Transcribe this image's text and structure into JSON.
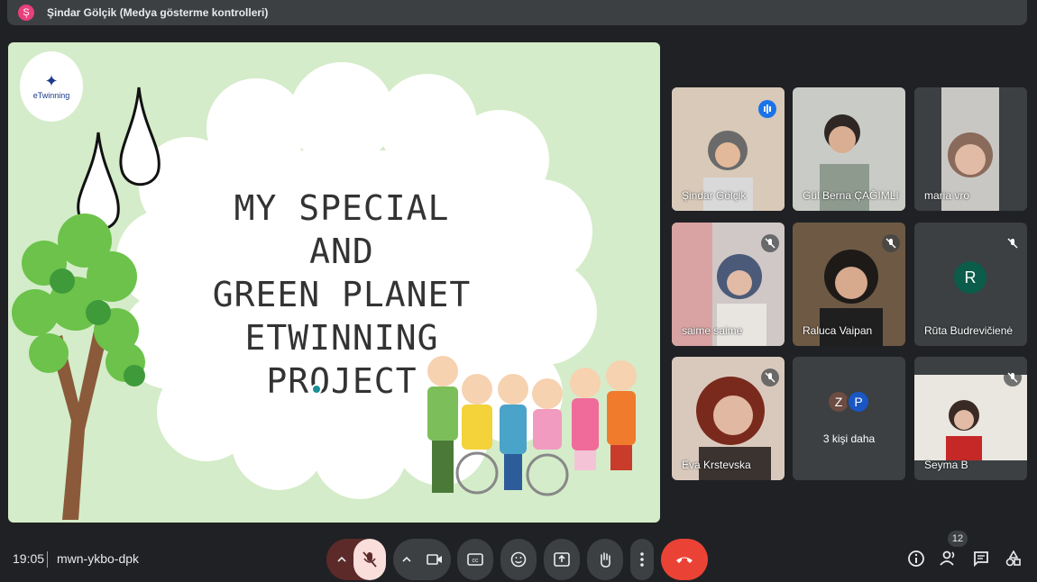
{
  "presenter": {
    "initial": "Ş",
    "label": "Şindar Gölçik (Medya gösterme kontrolleri)"
  },
  "slide": {
    "logo_text": "eTwinning",
    "title_lines": [
      "MY SPECIAL AND",
      "GREEN PLANET",
      "ETWINNING",
      "PROJECT"
    ]
  },
  "participants": [
    {
      "name": "Şindar Gölçik",
      "state": "speaking"
    },
    {
      "name": "Gül Berna ÇAĞIMLI",
      "state": "unmuted"
    },
    {
      "name": "maria vro",
      "state": "unmuted"
    },
    {
      "name": "saime saime",
      "state": "muted"
    },
    {
      "name": "Raluca Vaipan",
      "state": "muted"
    },
    {
      "name": "Rūta Budrevičienė",
      "state": "muted",
      "avatar_initial": "R"
    },
    {
      "name": "Eva Krstevska",
      "state": "muted"
    },
    {
      "name": "3 kişi daha",
      "more_initials": [
        "Z",
        "P"
      ]
    },
    {
      "name": "Seyma B",
      "state": "muted"
    }
  ],
  "bottom": {
    "time": "19:05",
    "meeting_code": "mwn-ykbo-dpk",
    "people_count": "12"
  },
  "colors": {
    "end_call": "#ea4335",
    "mic_off_bg": "#f9dedc",
    "speaking_ring": "#8ab4f8"
  }
}
